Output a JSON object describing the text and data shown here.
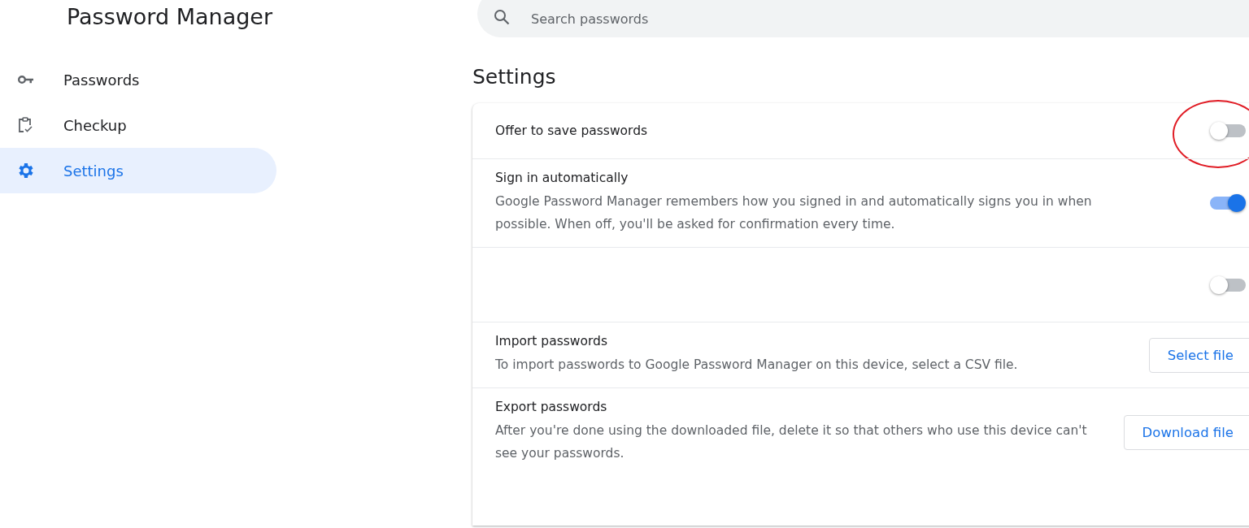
{
  "app_title": "Password Manager",
  "sidebar": {
    "items": [
      {
        "label": "Passwords",
        "selected": false
      },
      {
        "label": "Checkup",
        "selected": false
      },
      {
        "label": "Settings",
        "selected": true
      }
    ]
  },
  "search": {
    "placeholder": "Search passwords"
  },
  "section_title": "Settings",
  "settings": [
    {
      "kind": "toggle",
      "title": "Offer to save passwords",
      "on": false,
      "circled": true
    },
    {
      "kind": "toggle",
      "title": "Sign in automatically",
      "description": "Google Password Manager remembers how you signed in and automatically signs you in when possible. When off, you'll be asked for confirmation every time.",
      "on": true,
      "circled": false
    },
    {
      "kind": "toggle",
      "on": false,
      "circled": false
    },
    {
      "kind": "button",
      "title": "Import passwords",
      "description": "To import passwords to Google Password Manager on this device, select a CSV file.",
      "button_label": "Select file"
    },
    {
      "kind": "button",
      "title": "Export passwords",
      "description": "After you're done using the downloaded file, delete it so that others who use this device can't see your passwords.",
      "button_label": "Download file"
    }
  ]
}
